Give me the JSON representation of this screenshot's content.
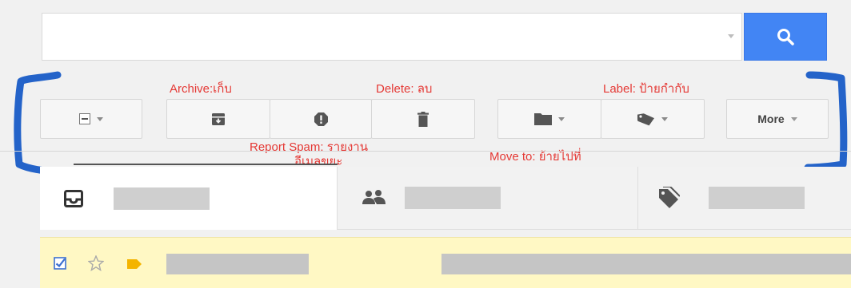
{
  "search": {
    "value": "",
    "placeholder": ""
  },
  "toolbar": {
    "more_label": "More"
  },
  "annotations": {
    "archive": "Archive:เก็บ",
    "delete": "Delete: ลบ",
    "label": "Label: ป้ายกำกับ",
    "report_spam_line1": "Report Spam: รายงาน",
    "report_spam_line2": "อีเมลขยะ",
    "move_to": "Move to: ย้ายไปที่"
  },
  "colors": {
    "accent_blue": "#4285f4",
    "annotation_red": "#e53935",
    "selected_row": "#fff8c4",
    "bracket_blue": "#2463c9",
    "label_yellow": "#f4b400"
  },
  "icons": {
    "search": "search-icon",
    "select_all": "checkbox-icon",
    "archive": "archive-icon",
    "report_spam": "report-spam-icon",
    "delete": "trash-icon",
    "move_to": "folder-icon",
    "labels": "tag-icon",
    "inbox_tab": "inbox-icon",
    "social_tab": "people-icon",
    "promotions_tab": "promotions-tag-icon",
    "row_checkbox": "checked-checkbox-icon",
    "row_star": "star-icon",
    "row_label": "label-marker-icon"
  }
}
